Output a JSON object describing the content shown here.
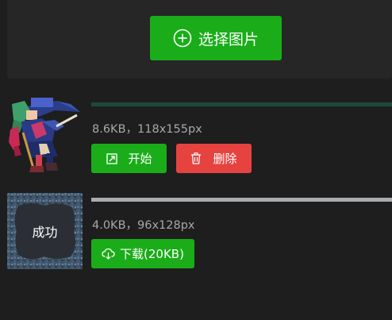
{
  "upload": {
    "button_label": "选择图片",
    "icon": "plus-circle-icon"
  },
  "items": [
    {
      "meta": "8.6KB，118x155px",
      "progress": 1.0,
      "progress_color": "#1f4a3a",
      "start_label": "开始",
      "delete_label": "删除",
      "start_icon": "expand-icon",
      "delete_icon": "trash-icon"
    },
    {
      "meta": "4.0KB，96x128px",
      "progress": 1.0,
      "progress_color": "#a9acae",
      "status": "成功",
      "download_label": "下载(20KB)",
      "download_icon": "cloud-download-icon"
    }
  ],
  "colors": {
    "primary": "#1aad19",
    "danger": "#e64340",
    "background": "#1e1e1e",
    "panel": "#262626"
  }
}
